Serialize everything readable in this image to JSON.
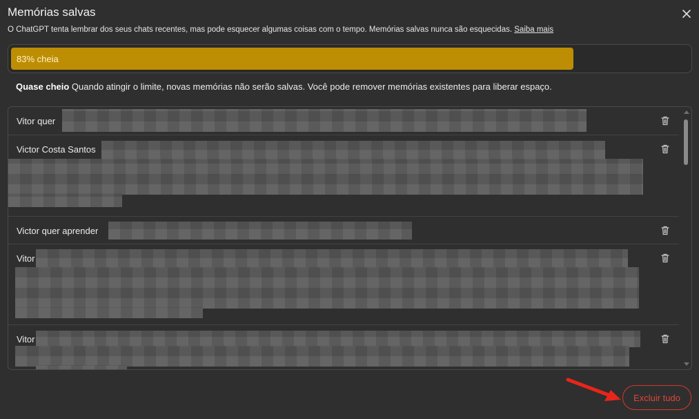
{
  "dialog": {
    "title": "Memórias salvas",
    "subtitle": "O ChatGPT tenta lembrar dos seus chats recentes, mas pode esquecer algumas coisas com o tempo. Memórias salvas nunca são esquecidas.",
    "learn_more": "Saiba mais"
  },
  "usage": {
    "label": "83% cheia",
    "percent": 83,
    "color": "#bd8e04"
  },
  "warning": {
    "bold": "Quase cheio",
    "text": " Quando atingir o limite, novas memórias não serão salvas. Você pode remover memórias existentes para liberar espaço."
  },
  "memories": [
    {
      "label": "Vitor quer"
    },
    {
      "label": "Victor Costa Santos"
    },
    {
      "label": "Victor quer aprender"
    },
    {
      "label": "Vitor"
    },
    {
      "label": "Vitor"
    }
  ],
  "actions": {
    "delete_all": "Excluir tudo"
  },
  "icons": {
    "close": "close-icon",
    "delete": "trash-icon",
    "annotation": "red-arrow"
  },
  "colors": {
    "accent_bar": "#bd8e04",
    "danger": "#d9372b"
  }
}
